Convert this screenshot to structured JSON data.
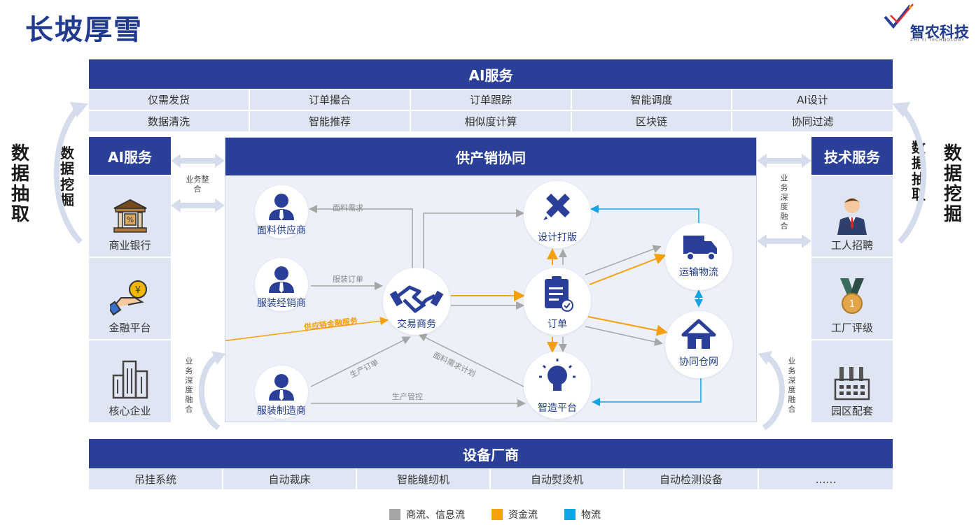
{
  "page_title": "长坡厚雪",
  "logo": {
    "text": "智农科技",
    "sub": "ZHI YI TECHNOLOGY"
  },
  "colors": {
    "navy": "#2a3f97",
    "cell": "#dfe5f3",
    "gray_flow": "#a6a6a6",
    "money_flow": "#f5a00c",
    "logistics_flow": "#12a4e6"
  },
  "top": {
    "title": "AI服务",
    "rows": [
      [
        "仅需发货",
        "订单撮合",
        "订单跟踪",
        "智能调度",
        "AI设计"
      ],
      [
        "数据清洗",
        "智能推荐",
        "相似度计算",
        "区块链",
        "协同过滤"
      ]
    ]
  },
  "left_panel": {
    "title": "AI服务",
    "items": [
      {
        "label": "商业银行",
        "icon": "bank-icon"
      },
      {
        "label": "金融平台",
        "icon": "coin-hand-icon"
      },
      {
        "label": "核心企业",
        "icon": "buildings-icon"
      }
    ]
  },
  "right_panel": {
    "title": "技术服务",
    "items": [
      {
        "label": "工人招聘",
        "icon": "worker-icon"
      },
      {
        "label": "工厂评级",
        "icon": "medal-icon"
      },
      {
        "label": "园区配套",
        "icon": "factory-icon"
      }
    ]
  },
  "left_outer": {
    "text1": "数据抽取",
    "text2": "数据挖掘"
  },
  "right_outer": {
    "text1": "数据抽取",
    "text2": "数据挖掘"
  },
  "small_labels": {
    "left_top": "业务整合",
    "left_bottom": "业务深度融合",
    "right_top": "业务深度融合",
    "right_bottom": "业务深度融合"
  },
  "center": {
    "title": "供产销协同",
    "nodes": {
      "fabric_supplier": "面料供应商",
      "apparel_dealer": "服装经销商",
      "apparel_maker": "服装制造商",
      "trade": "交易商务",
      "design": "设计打版",
      "order": "订单",
      "smart_platform": "智造平台",
      "transport": "运输物流",
      "warehouse": "协同仓网"
    },
    "edge_labels": {
      "fabric_demand": "面料需求",
      "apparel_order": "服装订单",
      "finance": "供应链金融服务",
      "production_order": "生产订单",
      "fabric_plan": "面料需求计划",
      "production_control": "生产管控"
    }
  },
  "bottom": {
    "title": "设备厂商",
    "cells": [
      "吊挂系统",
      "自动裁床",
      "智能缝纫机",
      "自动熨烫机",
      "自动检测设备",
      "……"
    ]
  },
  "legend": [
    {
      "label": "商流、信息流",
      "color": "#a6a6a6"
    },
    {
      "label": "资金流",
      "color": "#f5a00c"
    },
    {
      "label": "物流",
      "color": "#12a4e6"
    }
  ]
}
